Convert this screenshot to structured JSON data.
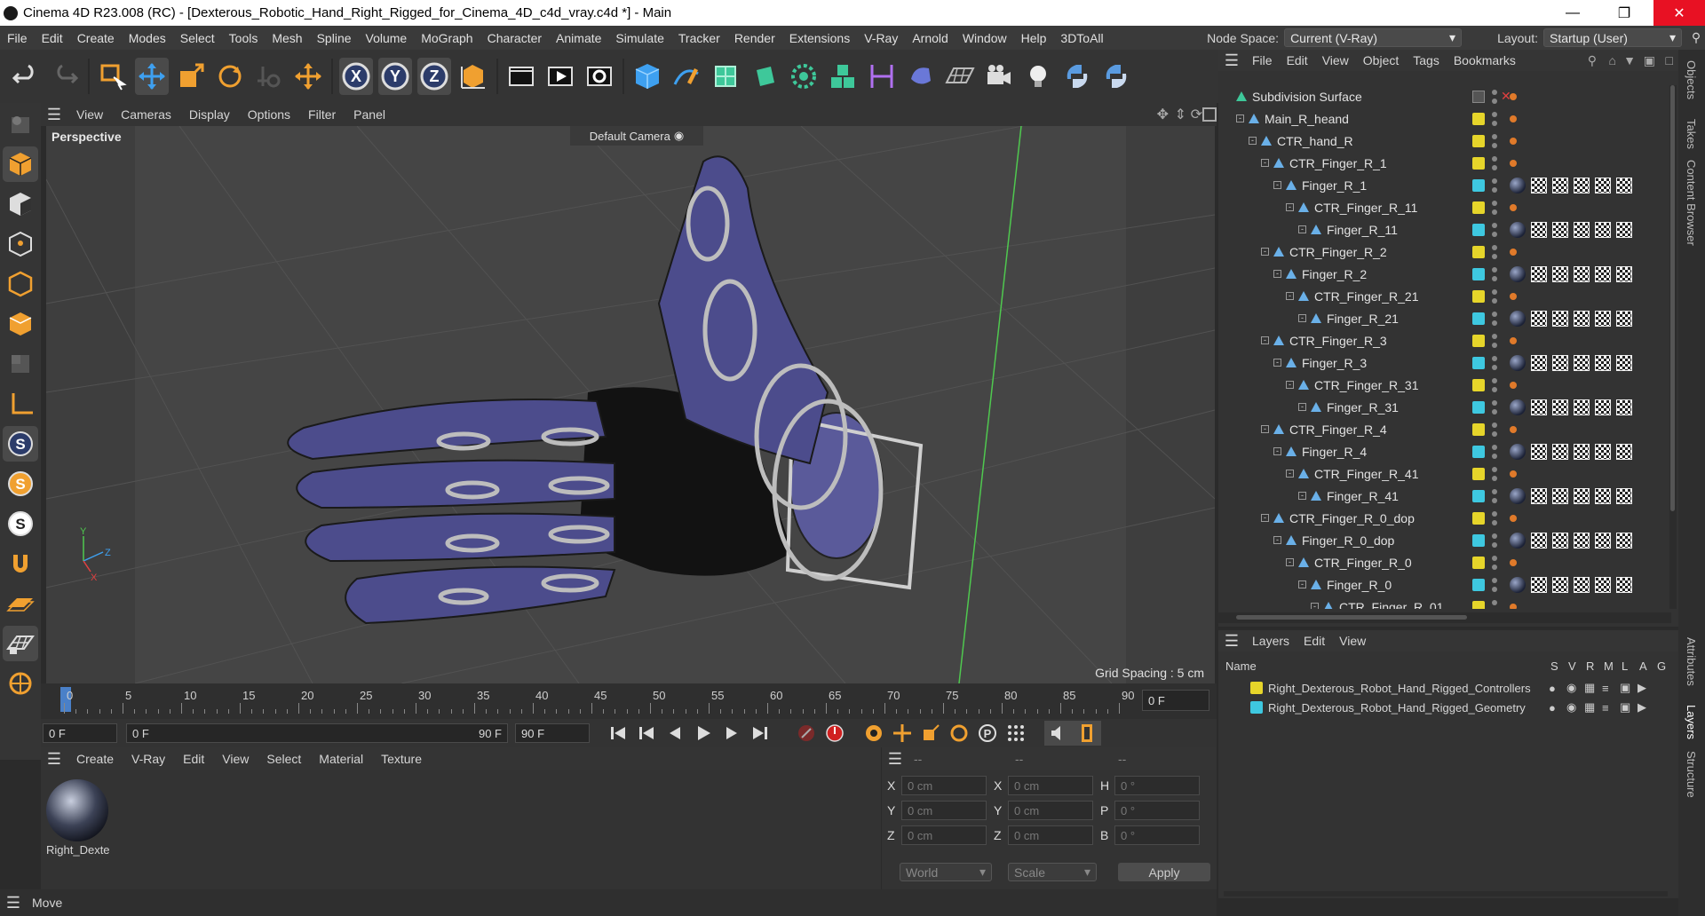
{
  "window": {
    "title": "Cinema 4D R23.008 (RC) - [Dexterous_Robotic_Hand_Right_Rigged_for_Cinema_4D_c4d_vray.c4d *] - Main"
  },
  "menubar": {
    "items": [
      "File",
      "Edit",
      "Create",
      "Modes",
      "Select",
      "Tools",
      "Mesh",
      "Spline",
      "Volume",
      "MoGraph",
      "Character",
      "Animate",
      "Simulate",
      "Tracker",
      "Render",
      "Extensions",
      "V-Ray",
      "Arnold",
      "Window",
      "Help",
      "3DToAll"
    ],
    "node_space_label": "Node Space:",
    "node_space_value": "Current (V-Ray)",
    "layout_label": "Layout:",
    "layout_value": "Startup (User)"
  },
  "viewport": {
    "menu": [
      "View",
      "Cameras",
      "Display",
      "Options",
      "Filter",
      "Panel"
    ],
    "view_name": "Perspective",
    "camera": "Default Camera",
    "grid_spacing": "Grid Spacing : 5 cm"
  },
  "timeline": {
    "ticks": [
      "0",
      "5",
      "10",
      "15",
      "20",
      "25",
      "30",
      "35",
      "40",
      "45",
      "50",
      "55",
      "60",
      "65",
      "70",
      "75",
      "80",
      "85",
      "90"
    ],
    "current_frame_right": "0 F",
    "start_field": "0 F",
    "range_start": "0 F",
    "range_end": "90 F",
    "end_field": "90 F"
  },
  "material_panel": {
    "menu": [
      "Create",
      "V-Ray",
      "Edit",
      "View",
      "Select",
      "Material",
      "Texture"
    ],
    "material_name": "Right_Dexte"
  },
  "coord_panel": {
    "headers": [
      "--",
      "--",
      "--"
    ],
    "rows": [
      {
        "a": "X",
        "av": "0 cm",
        "b": "X",
        "bv": "0 cm",
        "c": "H",
        "cv": "0 °"
      },
      {
        "a": "Y",
        "av": "0 cm",
        "b": "Y",
        "bv": "0 cm",
        "c": "P",
        "cv": "0 °"
      },
      {
        "a": "Z",
        "av": "0 cm",
        "b": "Z",
        "bv": "0 cm",
        "c": "B",
        "cv": "0 °"
      }
    ],
    "mode": "World",
    "scale_mode": "Scale",
    "apply": "Apply"
  },
  "status": {
    "text": "Move"
  },
  "objects": {
    "menu": [
      "File",
      "Edit",
      "View",
      "Object",
      "Tags",
      "Bookmarks"
    ],
    "tree": [
      {
        "name": "Subdivision Surface",
        "depth": 0,
        "color": "",
        "kind": "subd"
      },
      {
        "name": "Main_R_heand",
        "depth": 1,
        "color": "#e6d52a",
        "kind": "ctrl"
      },
      {
        "name": "CTR_hand_R",
        "depth": 2,
        "color": "#e6d52a",
        "kind": "ctrl"
      },
      {
        "name": "CTR_Finger_R_1",
        "depth": 3,
        "color": "#e6d52a",
        "kind": "ctrl"
      },
      {
        "name": "Finger_R_1",
        "depth": 4,
        "color": "#3ec8e0",
        "kind": "geo"
      },
      {
        "name": "CTR_Finger_R_11",
        "depth": 5,
        "color": "#e6d52a",
        "kind": "ctrl"
      },
      {
        "name": "Finger_R_11",
        "depth": 6,
        "color": "#3ec8e0",
        "kind": "geo"
      },
      {
        "name": "CTR_Finger_R_2",
        "depth": 3,
        "color": "#e6d52a",
        "kind": "ctrl"
      },
      {
        "name": "Finger_R_2",
        "depth": 4,
        "color": "#3ec8e0",
        "kind": "geo"
      },
      {
        "name": "CTR_Finger_R_21",
        "depth": 5,
        "color": "#e6d52a",
        "kind": "ctrl"
      },
      {
        "name": "Finger_R_21",
        "depth": 6,
        "color": "#3ec8e0",
        "kind": "geo"
      },
      {
        "name": "CTR_Finger_R_3",
        "depth": 3,
        "color": "#e6d52a",
        "kind": "ctrl"
      },
      {
        "name": "Finger_R_3",
        "depth": 4,
        "color": "#3ec8e0",
        "kind": "geo"
      },
      {
        "name": "CTR_Finger_R_31",
        "depth": 5,
        "color": "#e6d52a",
        "kind": "ctrl"
      },
      {
        "name": "Finger_R_31",
        "depth": 6,
        "color": "#3ec8e0",
        "kind": "geo"
      },
      {
        "name": "CTR_Finger_R_4",
        "depth": 3,
        "color": "#e6d52a",
        "kind": "ctrl"
      },
      {
        "name": "Finger_R_4",
        "depth": 4,
        "color": "#3ec8e0",
        "kind": "geo"
      },
      {
        "name": "CTR_Finger_R_41",
        "depth": 5,
        "color": "#e6d52a",
        "kind": "ctrl"
      },
      {
        "name": "Finger_R_41",
        "depth": 6,
        "color": "#3ec8e0",
        "kind": "geo"
      },
      {
        "name": "CTR_Finger_R_0_dop",
        "depth": 3,
        "color": "#e6d52a",
        "kind": "ctrl"
      },
      {
        "name": "Finger_R_0_dop",
        "depth": 4,
        "color": "#3ec8e0",
        "kind": "geo"
      },
      {
        "name": "CTR_Finger_R_0",
        "depth": 5,
        "color": "#e6d52a",
        "kind": "ctrl"
      },
      {
        "name": "Finger_R_0",
        "depth": 6,
        "color": "#3ec8e0",
        "kind": "geo"
      },
      {
        "name": "CTR_Finger_R_01",
        "depth": 7,
        "color": "#e6d52a",
        "kind": "ctrl"
      }
    ]
  },
  "layers": {
    "menu": [
      "Layers",
      "Edit",
      "View"
    ],
    "columns": [
      "Name",
      "S",
      "V",
      "R",
      "M",
      "L",
      "A",
      "G"
    ],
    "items": [
      {
        "name": "Right_Dexterous_Robot_Hand_Rigged_Controllers",
        "color": "#e6d52a"
      },
      {
        "name": "Right_Dexterous_Robot_Hand_Rigged_Geometry",
        "color": "#3ec8e0"
      }
    ]
  },
  "side_tabs": [
    "Objects",
    "Takes",
    "Content Browser",
    "Attributes",
    "Layers",
    "Structure"
  ]
}
